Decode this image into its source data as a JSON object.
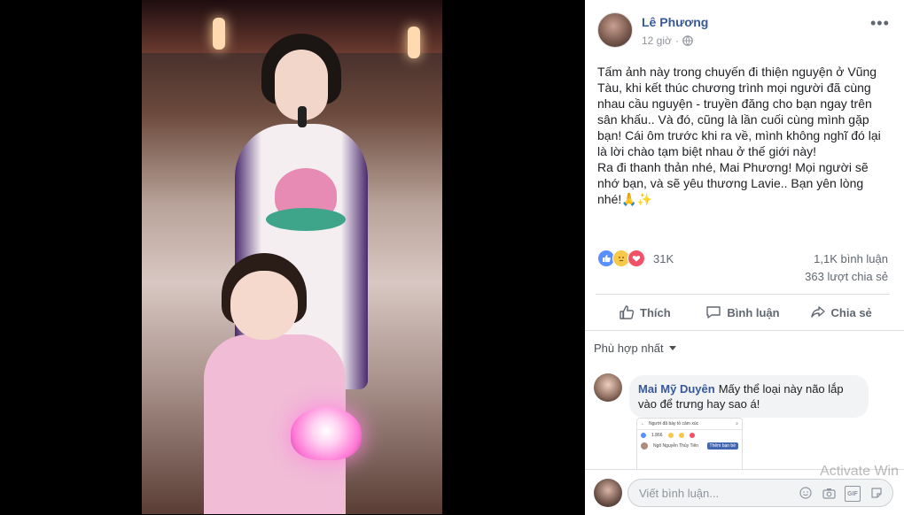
{
  "post": {
    "author": "Lê Phương",
    "time": "12 giờ",
    "text": "Tấm ảnh này trong chuyến đi thiện nguyện ở Vũng Tàu, khi kết thúc chương trình mọi người đã cùng nhau cầu nguyện - truyền đăng cho bạn ngay trên sân khấu.. Và đó, cũng là lần cuối cùng mình gặp bạn! Cái ôm trước khi ra về, mình không nghĩ đó lại là lời chào tạm biệt nhau ở thế giới này!\nRa đi thanh thản nhé, Mai Phương! Mọi người sẽ nhớ bạn, và sẽ yêu thương Lavie.. Bạn yên lòng nhé!🙏✨"
  },
  "stats": {
    "reactions": "31K",
    "comments": "1,1K bình luận",
    "shares": "363 lượt chia sẻ"
  },
  "actions": {
    "like": "Thích",
    "comment": "Bình luận",
    "share": "Chia sẻ"
  },
  "sort": {
    "label": "Phù hợp nhất"
  },
  "comment": {
    "name": "Mai Mỹ Duyên",
    "text": "Mấy thể loại này não lắp vào để trưng hay sao á!",
    "attachment": {
      "title": "Người đã bày tỏ cảm xúc",
      "count": "1.866",
      "person": "Ngô Nguyễn Thủy Tiên",
      "button": "Thêm bạn bè"
    }
  },
  "composer": {
    "placeholder": "Viết bình luận..."
  },
  "watermark": "Activate Win",
  "icons": {
    "reactions": [
      "like-icon",
      "sad-icon",
      "love-icon"
    ],
    "composer": [
      "emoji-icon",
      "camera-icon",
      "gif-icon",
      "sticker-icon"
    ]
  },
  "colors": {
    "link": "#365899",
    "like_blue": "#5890ff",
    "love_red": "#f25268",
    "sad_yellow": "#f7c94b"
  }
}
